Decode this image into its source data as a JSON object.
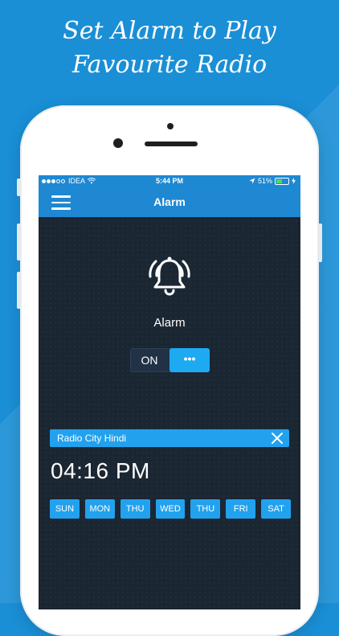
{
  "headline": {
    "line1": "Set Alarm to Play",
    "line2": "Favourite Radio"
  },
  "status_bar": {
    "carrier": "IDEA",
    "time": "5:44 PM",
    "battery": "51%",
    "battery_level": 0.51
  },
  "nav": {
    "title": "Alarm",
    "menu_icon": "hamburger-menu-icon"
  },
  "alarm": {
    "icon": "alarm-bell-icon",
    "label": "Alarm",
    "toggle_label": "ON",
    "toggle_knob": "•••"
  },
  "station": {
    "name": "Radio City Hindi",
    "close_icon": "close-icon"
  },
  "alarm_time": "04:16 PM",
  "days": [
    "SUN",
    "MON",
    "THU",
    "WED",
    "THU",
    "FRI",
    "SAT"
  ],
  "colors": {
    "background": "#1a8fd6",
    "header": "#1e88d2",
    "screen": "#1b2633",
    "accent": "#22a2ee",
    "toggle_knob": "#1eaaf1"
  }
}
